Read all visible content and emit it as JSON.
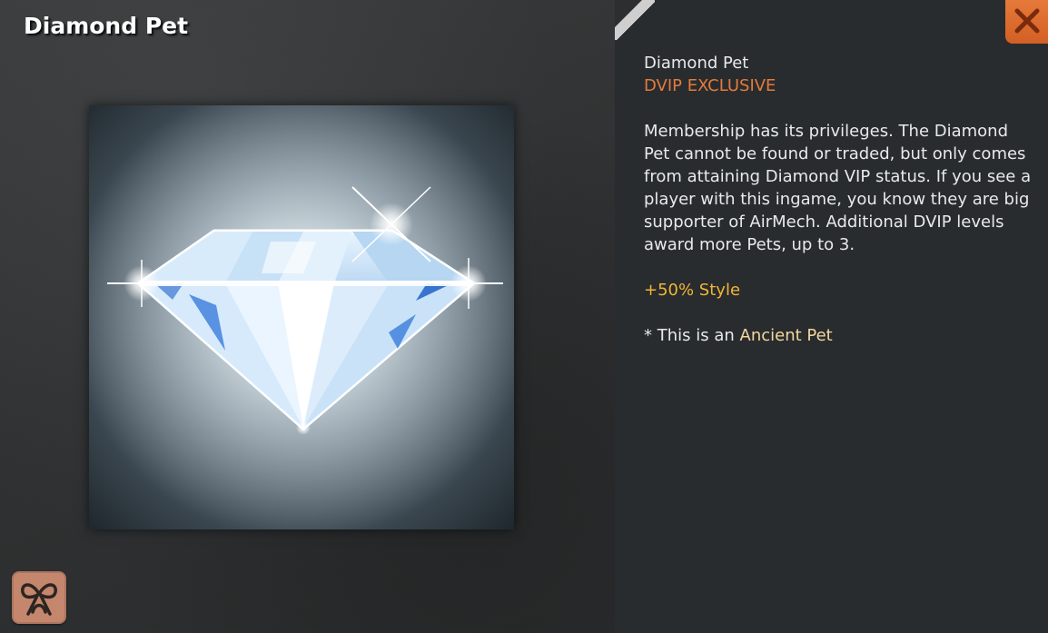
{
  "header": {
    "title": "Diamond Pet"
  },
  "preview": {
    "image_icon": "diamond-icon"
  },
  "details": {
    "name": "Diamond Pet",
    "tag": "DVIP EXCLUSIVE",
    "description": "Membership has its privileges. The Diamond Pet cannot be found or traded, but only comes from attaining Diamond VIP status. If you see a player with this ingame, you know they are big supporter of AirMech. Additional DVIP levels award more Pets, up to 3.",
    "bonus": "+50% Style",
    "tier_prefix": "* This is an ",
    "tier_value": "Ancient Pet"
  },
  "buttons": {
    "close_icon": "close-icon",
    "ribbon_icon": "ribbon-icon"
  },
  "colors": {
    "accent_orange": "#e57a3b",
    "bonus_gold": "#f2b533",
    "tier_gold": "#f4d79c",
    "panel_bg": "#282c2f"
  }
}
